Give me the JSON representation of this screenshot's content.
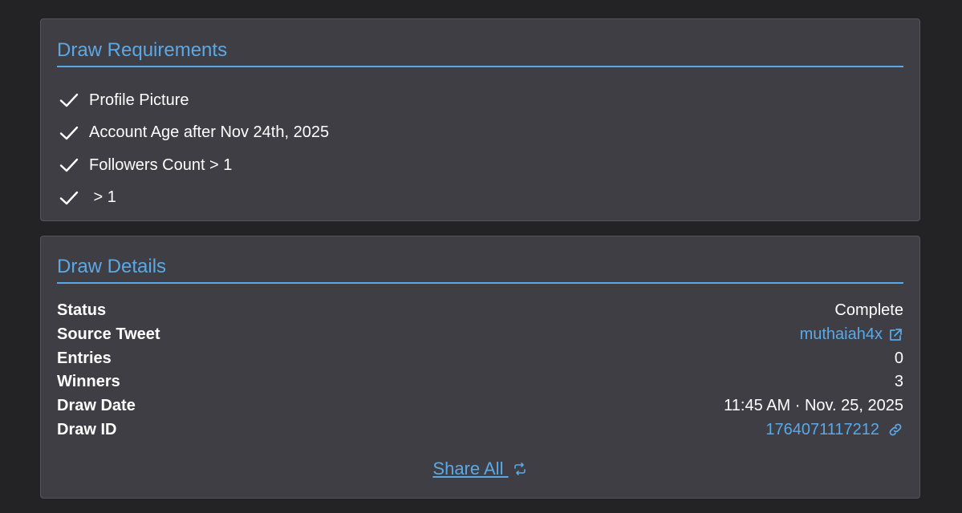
{
  "requirements": {
    "title": "Draw Requirements",
    "items": [
      {
        "label": "Profile Picture"
      },
      {
        "label": "Account Age after Nov 24th, 2025"
      },
      {
        "label": "Followers Count > 1"
      },
      {
        "label": " > 1"
      }
    ]
  },
  "details": {
    "title": "Draw Details",
    "rows": [
      {
        "label": "Status",
        "value": "Complete"
      },
      {
        "label": "Source Tweet",
        "value": "muthaiah4x",
        "icon": "external-link-icon"
      },
      {
        "label": "Entries",
        "value": "0"
      },
      {
        "label": "Winners",
        "value": "3"
      },
      {
        "label": "Draw Date",
        "value": "11:45 AM · Nov. 25, 2025"
      },
      {
        "label": "Draw ID",
        "value": "1764071117212",
        "icon": "link-icon"
      }
    ],
    "share_label": "Share All ",
    "share_icon": "share-icon"
  },
  "colors": {
    "background": "#232325",
    "card": "#3f3e45",
    "accent": "#5aa9e6",
    "text": "#ffffff"
  }
}
